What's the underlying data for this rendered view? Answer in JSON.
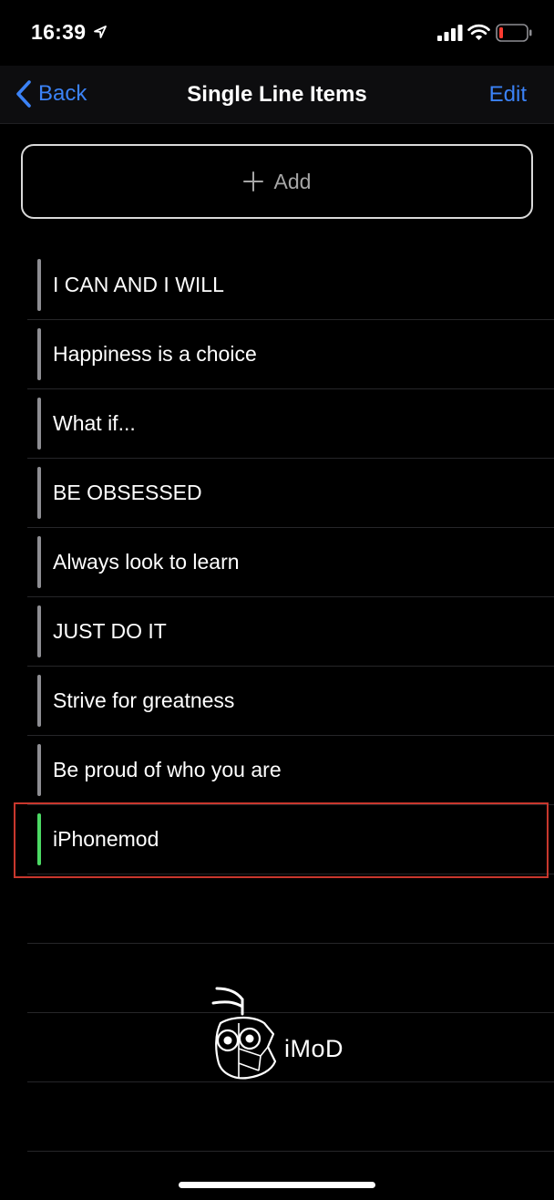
{
  "status_bar": {
    "time": "16:39",
    "battery_color": "#ff3b30"
  },
  "nav": {
    "back_label": "Back",
    "title": "Single Line Items",
    "edit_label": "Edit",
    "accent_color": "#3b82f6"
  },
  "add_button": {
    "label": "Add",
    "icon": "plus-icon"
  },
  "items": [
    {
      "text": "I CAN AND I WILL",
      "color": "#8e8e93"
    },
    {
      "text": "Happiness is a choice",
      "color": "#8e8e93"
    },
    {
      "text": "What if...",
      "color": "#8e8e93"
    },
    {
      "text": "BE OBSESSED",
      "color": "#8e8e93"
    },
    {
      "text": "Always look to learn",
      "color": "#8e8e93"
    },
    {
      "text": "JUST DO IT",
      "color": "#8e8e93"
    },
    {
      "text": "Strive for greatness",
      "color": "#8e8e93"
    },
    {
      "text": "Be proud of who you are",
      "color": "#8e8e93"
    },
    {
      "text": "iPhonemod",
      "color": "#4cd964"
    }
  ],
  "watermark": {
    "text": "iMoD"
  }
}
